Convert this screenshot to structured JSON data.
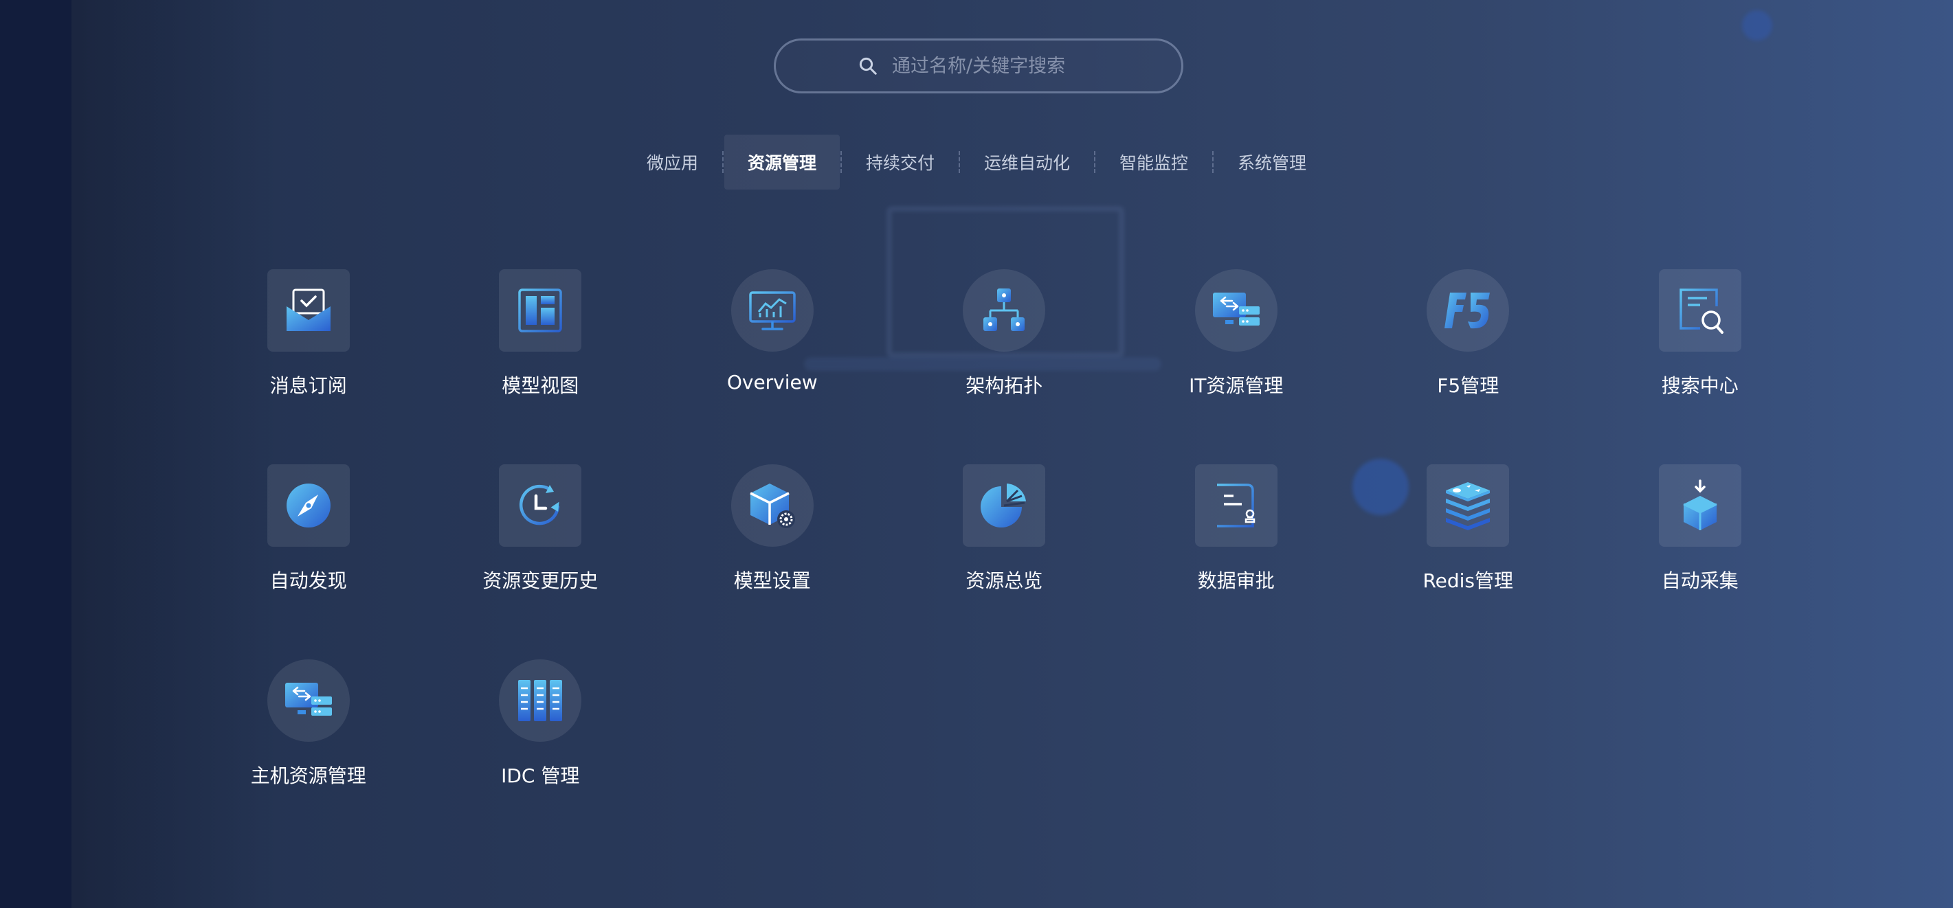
{
  "search": {
    "placeholder": "通过名称/关键字搜索"
  },
  "tabs": [
    {
      "label": "微应用",
      "active": false
    },
    {
      "label": "资源管理",
      "active": true
    },
    {
      "label": "持续交付",
      "active": false
    },
    {
      "label": "运维自动化",
      "active": false
    },
    {
      "label": "智能监控",
      "active": false
    },
    {
      "label": "系统管理",
      "active": false
    }
  ],
  "apps": [
    {
      "label": "消息订阅",
      "icon": "mail-check-icon",
      "shape": "square"
    },
    {
      "label": "模型视图",
      "icon": "layout-panel-icon",
      "shape": "square"
    },
    {
      "label": "Overview",
      "icon": "monitor-chart-icon",
      "shape": "circle"
    },
    {
      "label": "架构拓扑",
      "icon": "topology-icon",
      "shape": "circle"
    },
    {
      "label": "IT资源管理",
      "icon": "monitor-server-icon",
      "shape": "circle"
    },
    {
      "label": "F5管理",
      "icon": "f5-logo-icon",
      "shape": "circle"
    },
    {
      "label": "搜索中心",
      "icon": "document-search-icon",
      "shape": "square"
    },
    {
      "label": "自动发现",
      "icon": "compass-icon",
      "shape": "square"
    },
    {
      "label": "资源变更历史",
      "icon": "history-clock-icon",
      "shape": "square"
    },
    {
      "label": "模型设置",
      "icon": "cube-gear-icon",
      "shape": "circle"
    },
    {
      "label": "资源总览",
      "icon": "pie-chart-icon",
      "shape": "square"
    },
    {
      "label": "数据审批",
      "icon": "document-approval-icon",
      "shape": "square"
    },
    {
      "label": "Redis管理",
      "icon": "redis-stack-icon",
      "shape": "square"
    },
    {
      "label": "自动采集",
      "icon": "box-download-icon",
      "shape": "square"
    },
    {
      "label": "主机资源管理",
      "icon": "monitor-server-icon",
      "shape": "circle"
    },
    {
      "label": "IDC 管理",
      "icon": "server-rack-icon",
      "shape": "circle"
    }
  ],
  "colors": {
    "accent": "#3a8ee6",
    "accent_light": "#5ec3f0",
    "accent_dark": "#2a5fd0"
  }
}
